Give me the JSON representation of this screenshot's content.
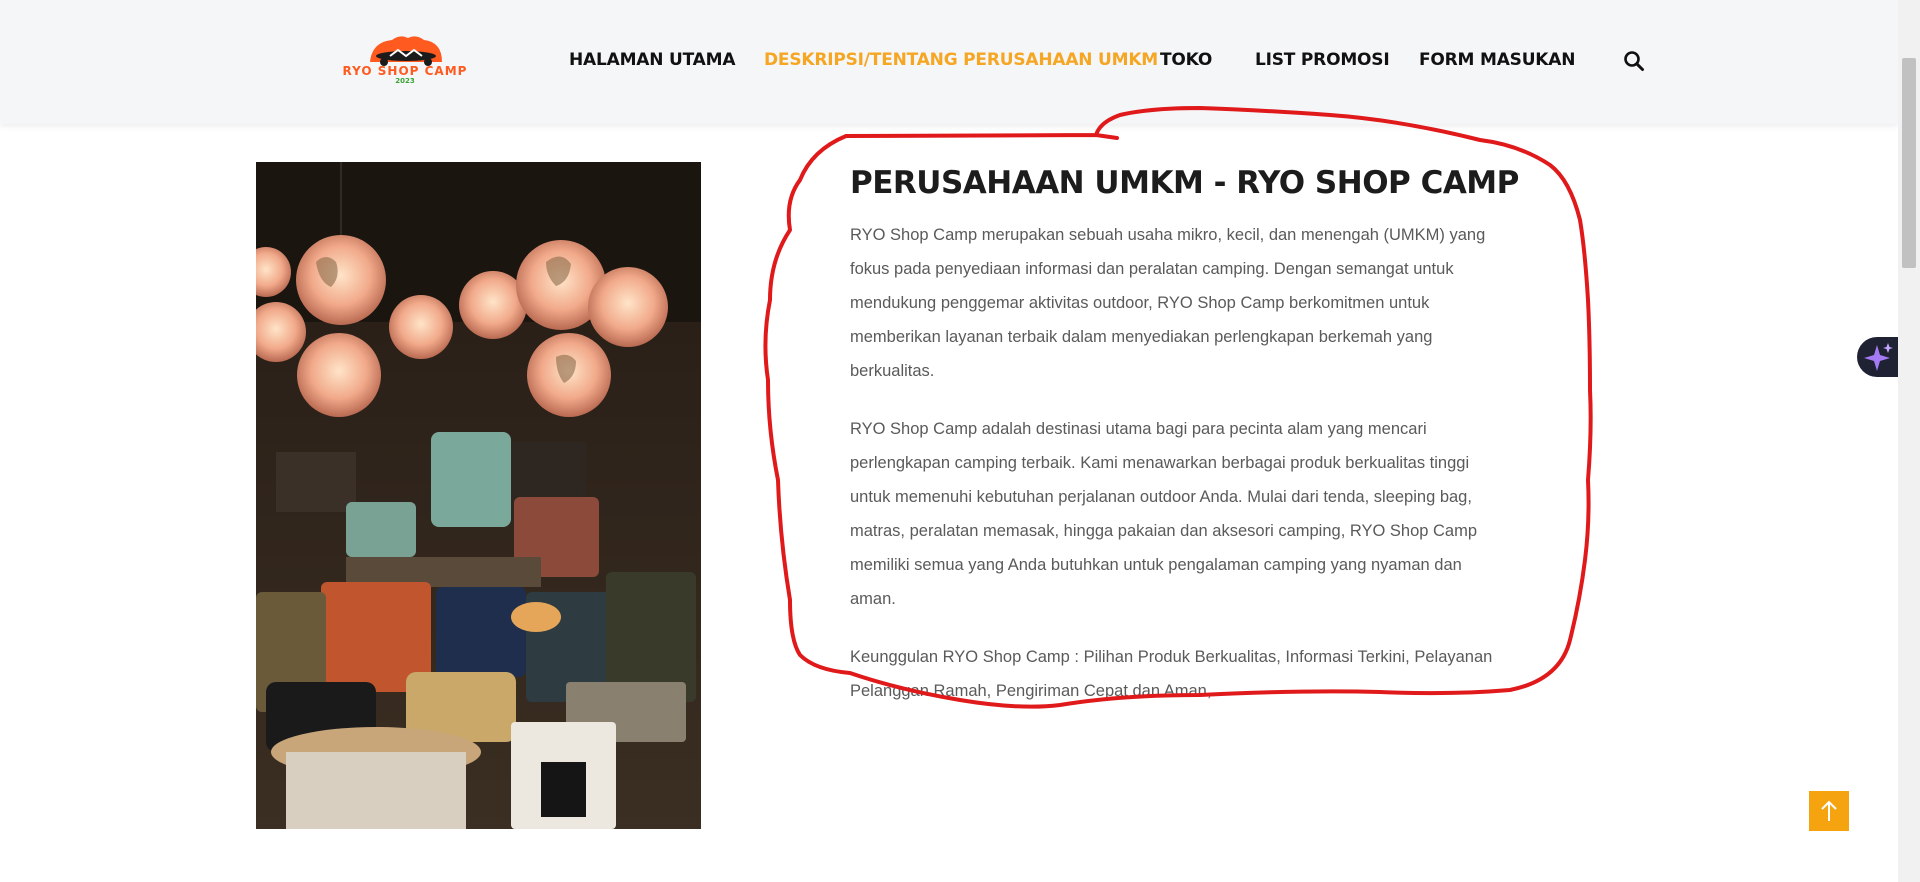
{
  "header": {
    "logo": {
      "text": "RYO SHOP CAMP",
      "year": "2023"
    },
    "nav": [
      {
        "label": "HALAMAN UTAMA",
        "active": false
      },
      {
        "label": "DESKRIPSI/TENTANG PERUSAHAAN UMKM",
        "active": true
      },
      {
        "label": "TOKO",
        "active": false
      },
      {
        "label": "LIST PROMOSI",
        "active": false
      },
      {
        "label": "FORM MASUKAN",
        "active": false
      }
    ],
    "search_icon": "search-icon"
  },
  "main": {
    "image_icon": "shop-photo",
    "title": "PERUSAHAAN UMKM - RYO SHOP CAMP",
    "paragraphs": [
      "RYO Shop Camp merupakan sebuah usaha mikro, kecil, dan menengah (UMKM) yang fokus pada penyediaan informasi dan peralatan camping. Dengan semangat untuk mendukung penggemar aktivitas outdoor, RYO Shop Camp berkomitmen untuk memberikan layanan terbaik dalam menyediakan perlengkapan berkemah yang berkualitas.",
      "RYO Shop Camp adalah destinasi utama bagi para pecinta alam yang mencari perlengkapan camping terbaik. Kami menawarkan berbagai produk berkualitas tinggi untuk memenuhi kebutuhan perjalanan outdoor Anda. Mulai dari tenda, sleeping bag, matras, peralatan memasak, hingga pakaian dan aksesori camping, RYO Shop Camp memiliki semua yang Anda butuhkan untuk pengalaman camping yang nyaman dan aman.",
      "Keunggulan RYO Shop Camp : Pilihan Produk Berkualitas, Informasi Terkini, Pelayanan Pelanggan Ramah, Pengiriman Cepat dan Aman,"
    ]
  },
  "widgets": {
    "ai_badge_icon": "sparkle-icon",
    "back_to_top_icon": "arrow-up-icon"
  },
  "colors": {
    "accent": "#f5a623",
    "nav_text": "#111111",
    "annotation": "#e0191b",
    "back_to_top": "#f5a30f"
  }
}
